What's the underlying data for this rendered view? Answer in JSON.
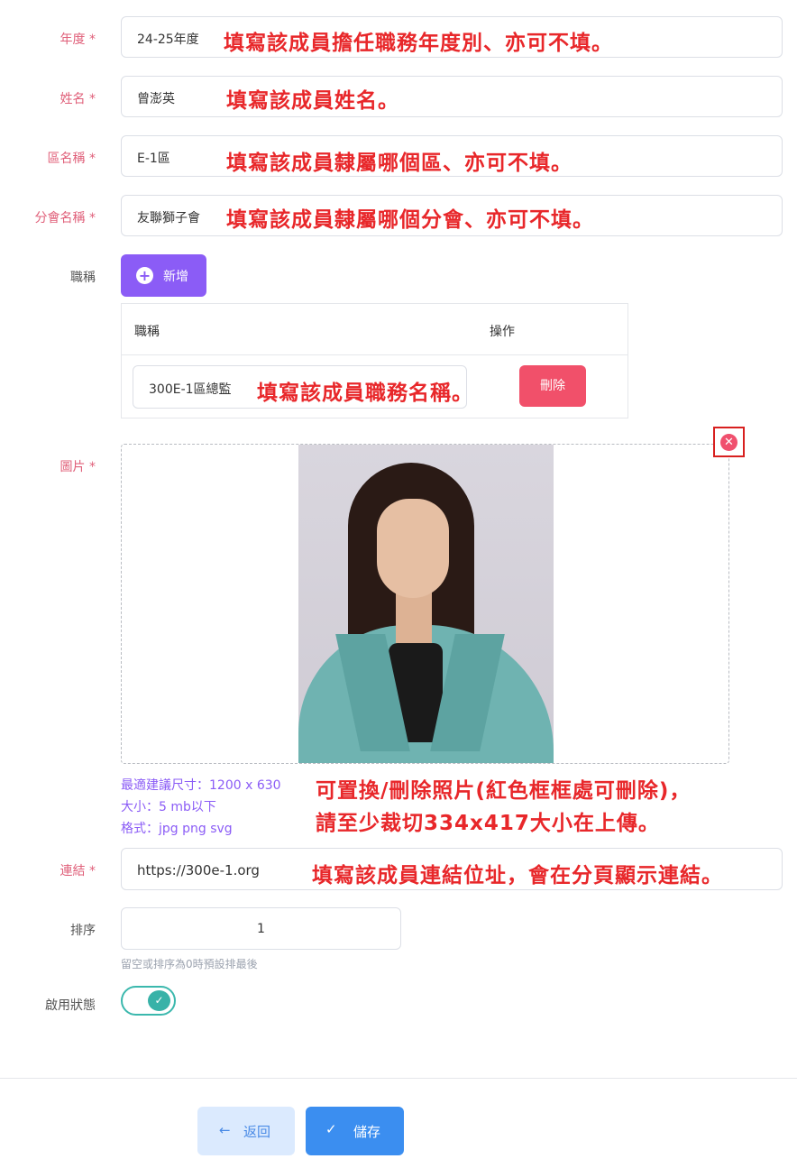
{
  "fields": {
    "year": {
      "label": "年度 *",
      "value": "24-25年度",
      "annotation": "填寫該成員擔任職務年度別、亦可不填。"
    },
    "name": {
      "label": "姓名 *",
      "value": "曾澎英",
      "annotation": "填寫該成員姓名。"
    },
    "district": {
      "label": "區名稱 *",
      "value": "E-1區",
      "annotation": "填寫該成員隸屬哪個區、亦可不填。"
    },
    "club": {
      "label": "分會名稱 *",
      "value": "友聯獅子會",
      "annotation": "填寫該成員隸屬哪個分會、亦可不填。"
    }
  },
  "title_section": {
    "label": "職稱",
    "add_button": "新增",
    "table": {
      "headers": [
        "職稱",
        "操作"
      ],
      "rows": [
        {
          "title": "300E-1區總監",
          "delete_label": "刪除"
        }
      ],
      "annotation": "填寫該成員職務名稱。"
    }
  },
  "image_section": {
    "label": "圖片 *",
    "hints": [
      "最適建議尺寸：1200 x 630",
      "大小：5 mb以下",
      "格式：jpg png svg"
    ],
    "annotation_line1": "可置換/刪除照片(紅色框框處可刪除)，",
    "annotation_line2": "請至少裁切334x417大小在上傳。"
  },
  "link": {
    "label": "連結 *",
    "value": "https://300e-1.org",
    "annotation": "填寫該成員連結位址，會在分頁顯示連結。"
  },
  "sort": {
    "label": "排序",
    "value": "1",
    "hint": "留空或排序為0時預設排最後"
  },
  "status": {
    "label": "啟用狀態",
    "enabled": true
  },
  "footer": {
    "back_label": "返回",
    "save_label": "儲存"
  },
  "colors": {
    "annotation_red": "#e8272a",
    "purple": "#8b5cf6",
    "delete_red": "#f1506a",
    "save_blue": "#3b8ef0",
    "toggle_teal": "#38b2a8"
  }
}
